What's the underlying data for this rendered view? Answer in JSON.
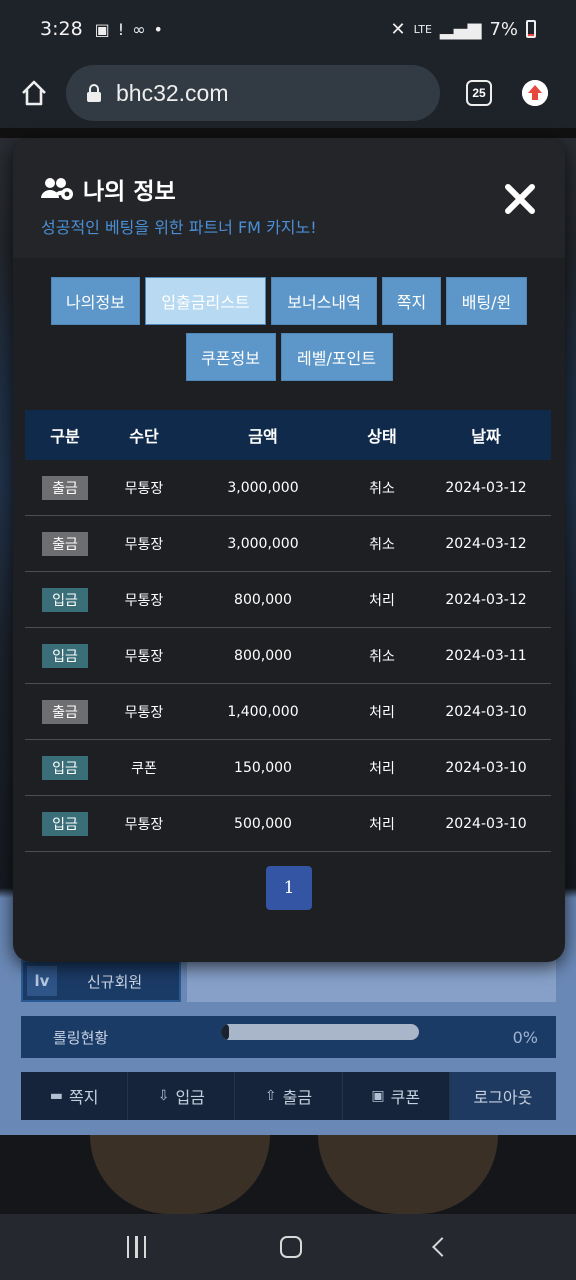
{
  "status_bar": {
    "time": "3:28",
    "battery": "7%",
    "network": "LTE"
  },
  "browser": {
    "url": "bhc32.com",
    "tab_count": "25"
  },
  "modal": {
    "title": "나의 정보",
    "subtitle": "성공적인 베팅을 위한 파트너 FM 카지노!",
    "tabs_row1": [
      "나의정보",
      "입출금리스트",
      "보너스내역",
      "쪽지",
      "배팅/윈"
    ],
    "tabs_row2": [
      "쿠폰정보",
      "레벨/포인트"
    ],
    "active_tab": "입출금리스트",
    "table": {
      "headers": [
        "구분",
        "수단",
        "금액",
        "상태",
        "날짜"
      ],
      "rows": [
        {
          "type": "출금",
          "kind": "out",
          "method": "무통장",
          "amount": "3,000,000",
          "status": "취소",
          "date": "2024-03-12"
        },
        {
          "type": "출금",
          "kind": "out",
          "method": "무통장",
          "amount": "3,000,000",
          "status": "취소",
          "date": "2024-03-12"
        },
        {
          "type": "입금",
          "kind": "in",
          "method": "무통장",
          "amount": "800,000",
          "status": "처리",
          "date": "2024-03-12"
        },
        {
          "type": "입금",
          "kind": "in",
          "method": "무통장",
          "amount": "800,000",
          "status": "취소",
          "date": "2024-03-11"
        },
        {
          "type": "출금",
          "kind": "out",
          "method": "무통장",
          "amount": "1,400,000",
          "status": "처리",
          "date": "2024-03-10"
        },
        {
          "type": "입금",
          "kind": "in",
          "method": "쿠폰",
          "amount": "150,000",
          "status": "처리",
          "date": "2024-03-10"
        },
        {
          "type": "입금",
          "kind": "in",
          "method": "무통장",
          "amount": "500,000",
          "status": "처리",
          "date": "2024-03-10"
        }
      ]
    },
    "pagination": {
      "current_page": "1"
    }
  },
  "background_page": {
    "level_tag": "lv",
    "level_name": "신규회원",
    "rolling_label": "롤링현황",
    "rolling_percent": "0%",
    "rolling_progress": 0.04,
    "actions": [
      {
        "label": "쪽지",
        "icon": "message-icon"
      },
      {
        "label": "입금",
        "icon": "download-icon"
      },
      {
        "label": "출금",
        "icon": "upload-icon"
      },
      {
        "label": "쿠폰",
        "icon": "money-icon"
      },
      {
        "label": "로그아웃",
        "icon": ""
      }
    ]
  },
  "colors": {
    "accent_blue": "#4a8fd6",
    "tab": "#5d97c9",
    "tab_active": "#b7daf2",
    "table_header": "#0f2a4a",
    "badge_out": "#6e6e70",
    "badge_in": "#3a6e78",
    "pager": "#3454a4"
  }
}
